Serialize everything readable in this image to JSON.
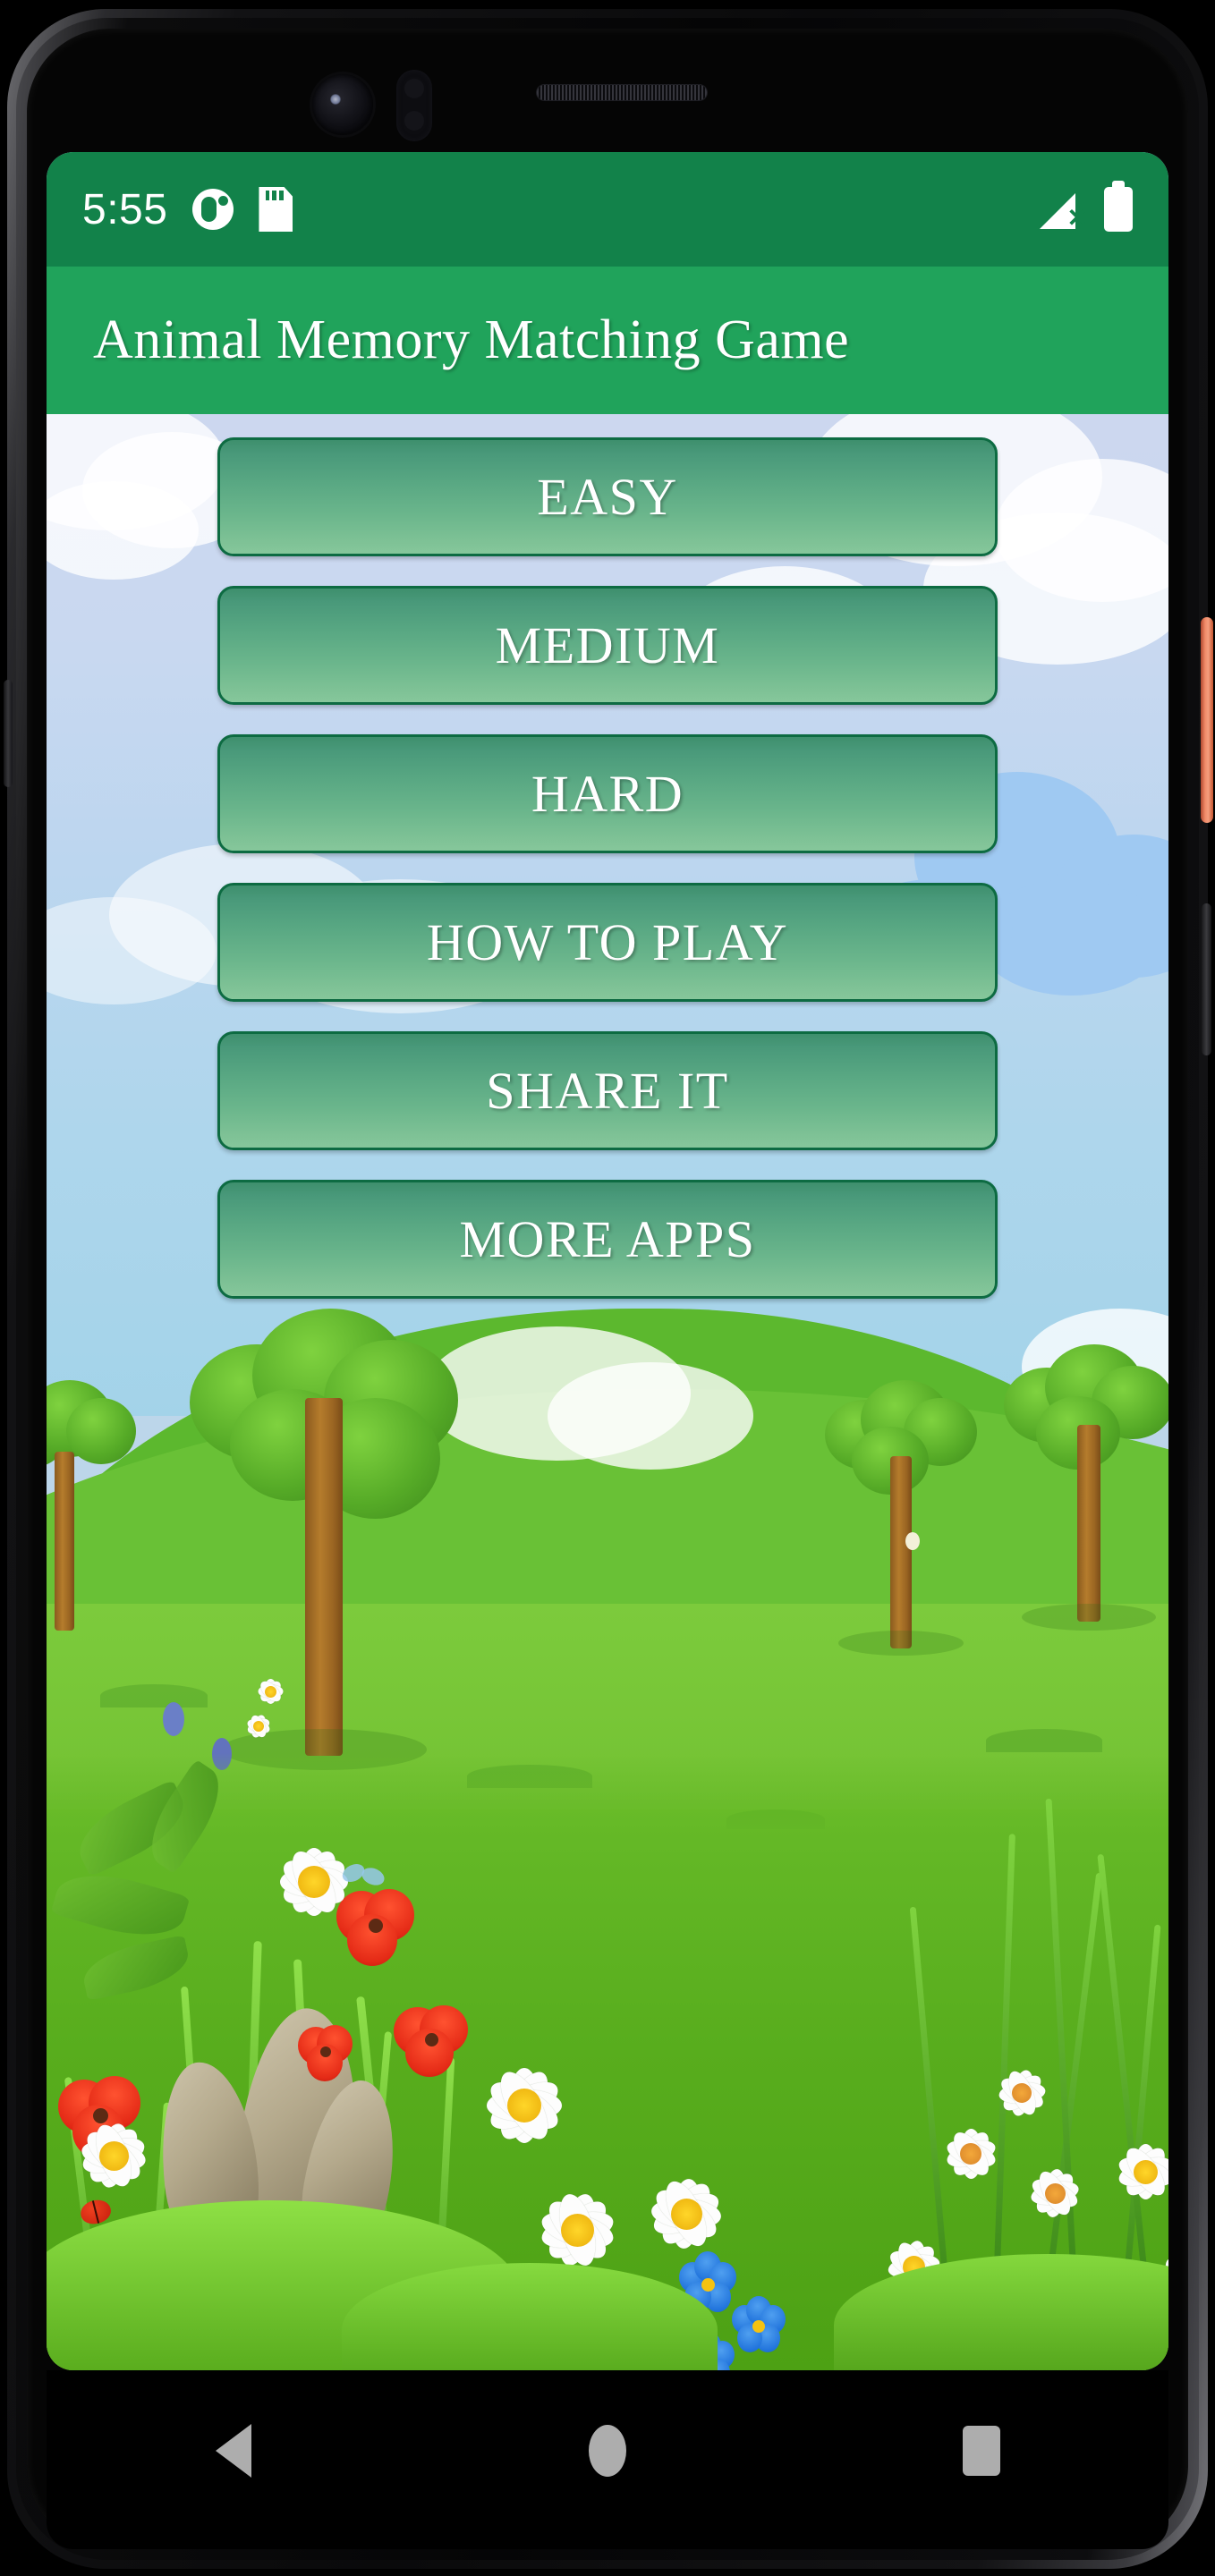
{
  "status_bar": {
    "time": "5:55",
    "left_icons": [
      "app-notification-icon",
      "sd-card-icon"
    ],
    "right_icons": [
      "signal-no-service-icon",
      "battery-full-icon"
    ],
    "background_color": "#12824a",
    "signal_x_label": "✕"
  },
  "app_bar": {
    "title": "Animal Memory Matching Game",
    "background_color": "#20a35b",
    "text_color": "#ffffff"
  },
  "menu": {
    "buttons": [
      {
        "label": "EASY",
        "name": "easy-button"
      },
      {
        "label": "MEDIUM",
        "name": "medium-button"
      },
      {
        "label": "HARD",
        "name": "hard-button"
      },
      {
        "label": "HOW TO PLAY",
        "name": "how-to-play-button"
      },
      {
        "label": "SHARE IT",
        "name": "share-it-button"
      },
      {
        "label": "MORE APPS",
        "name": "more-apps-button"
      }
    ],
    "button_border_color": "#0d6b42",
    "button_text_color": "#ffffff"
  },
  "background": {
    "description": "cartoon meadow scene with blue sky, white and blue clouds, green rolling hills, trees, and a foreground band of daisies, red poppies, blue flowers, rocks and grass",
    "sky_top_color": "#ccd7ef",
    "sky_bottom_color": "#a3d3e9",
    "hill_color": "#5cb82e",
    "field_color": "#74c233",
    "meadow_color": "#58ad1d"
  },
  "nav_bar": {
    "buttons": [
      {
        "label": "Back",
        "name": "nav-back-button"
      },
      {
        "label": "Home",
        "name": "nav-home-button"
      },
      {
        "label": "Recents",
        "name": "nav-recents-button"
      }
    ],
    "background_color": "#000000",
    "icon_color": "#adadad"
  },
  "device": {
    "hardware": [
      "front-camera",
      "proximity-sensor",
      "earpiece-speaker",
      "power-button",
      "volume-button"
    ],
    "power_button_color": "#f08a68"
  }
}
